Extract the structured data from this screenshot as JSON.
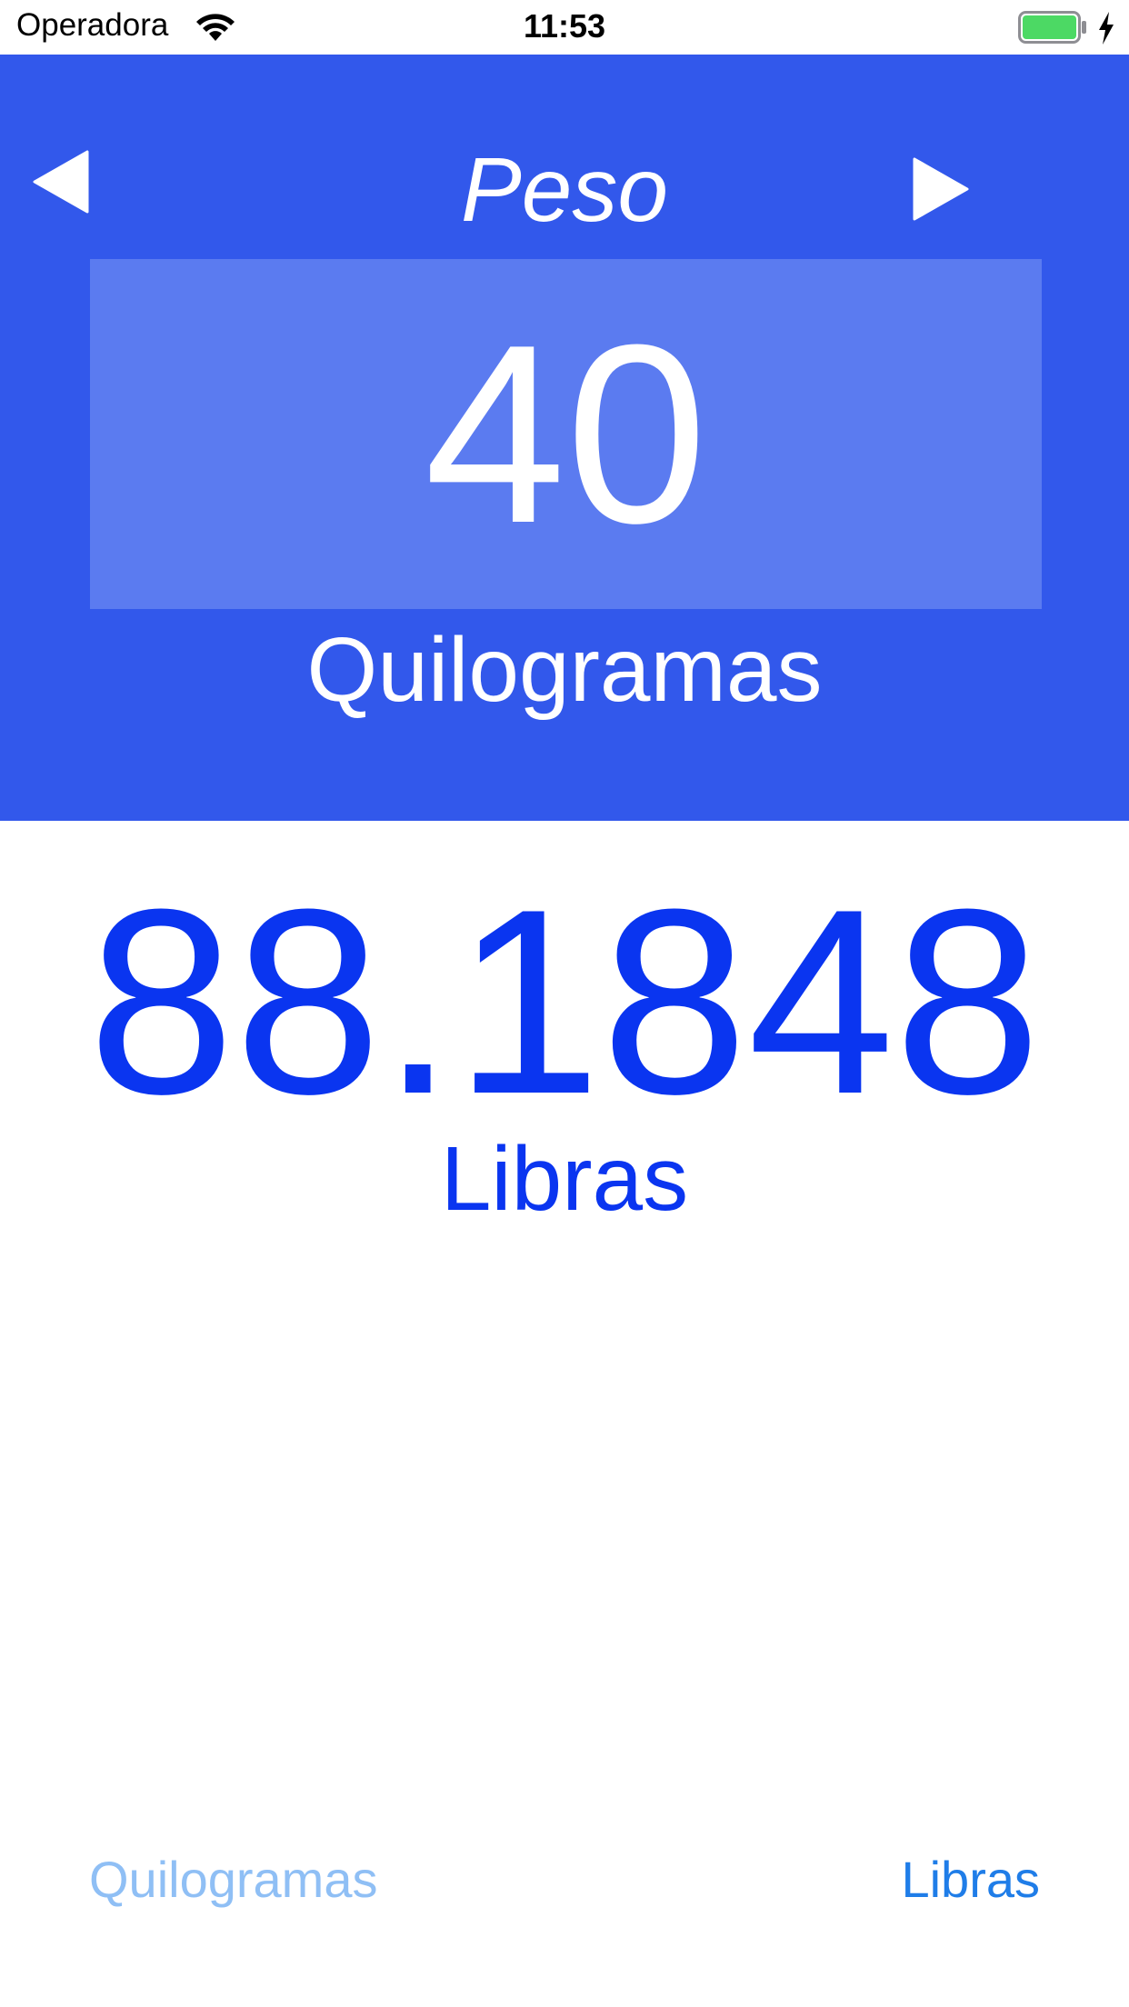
{
  "status_bar": {
    "carrier": "Operadora",
    "time": "11:53",
    "wifi_icon": "wifi-icon",
    "battery_icon": "battery-icon",
    "charging_icon": "charging-bolt-icon",
    "battery_level": 1.0
  },
  "converter": {
    "category": "Peso",
    "prev_icon": "triangle-left-icon",
    "next_icon": "triangle-right-icon",
    "input_value": "40",
    "input_unit": "Quilogramas",
    "result_value": "88.1848",
    "result_unit": "Libras"
  },
  "unit_selector": {
    "from_label": "Quilogramas",
    "to_label": "Libras"
  },
  "colors": {
    "header_background": "#3258eb",
    "input_box_background": "#5b7bf0",
    "result_text": "#0a35f0",
    "unit_from_text": "#8fbff5",
    "unit_to_text": "#1f7de8",
    "battery_fill": "#4cd964"
  }
}
